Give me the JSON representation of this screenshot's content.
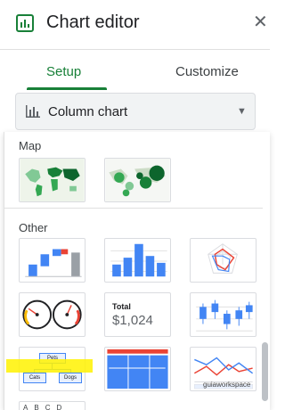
{
  "header": {
    "title": "Chart editor",
    "app_icon": "chart-icon",
    "close": "✕"
  },
  "tabs": [
    {
      "label": "Setup",
      "active": true
    },
    {
      "label": "Customize",
      "active": false
    }
  ],
  "chart_type": {
    "label": "Column chart",
    "icon": "column-chart-icon",
    "caret": "▼"
  },
  "sections": [
    {
      "label": "Map",
      "items": [
        "geo-chart",
        "geo-bubble-chart"
      ]
    },
    {
      "label": "Other",
      "items": [
        "waterfall-chart",
        "histogram-chart",
        "radar-chart",
        "gauge-chart",
        "scorecard-chart",
        "candlestick-chart",
        "org-chart",
        "treemap-chart",
        "timeline-chart",
        "table-chart"
      ]
    }
  ],
  "scorecard": {
    "label": "Total",
    "value": "$1,024"
  },
  "org_chart": {
    "root": "Pets",
    "left": "Cats",
    "right": "Dogs"
  },
  "table_preview": {
    "headers": [
      "A",
      "B",
      "C",
      "D"
    ]
  },
  "watermark": "guiaworkspace",
  "colors": {
    "accent": "#188038",
    "blue": "#4285f4",
    "red": "#ea4335",
    "highlight": "#fff200"
  }
}
